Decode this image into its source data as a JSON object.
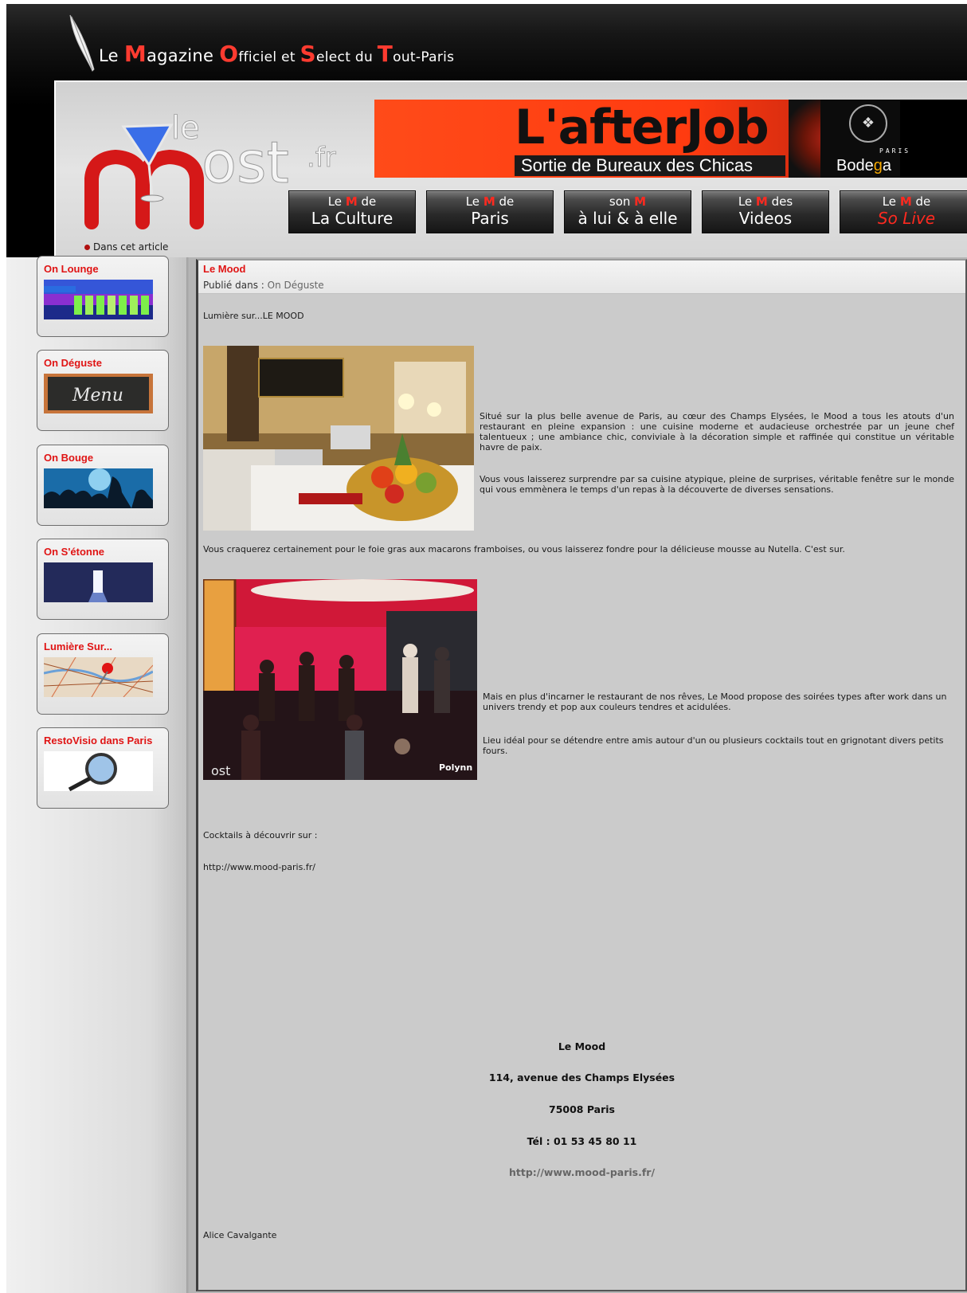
{
  "header": {
    "tagline": {
      "w1": "Le ",
      "c1": "M",
      "w2": "agazine ",
      "c2": "O",
      "w3": "fficiel ",
      "w4": "et ",
      "c3": "S",
      "w5": "elect ",
      "w6": "du ",
      "c4": "T",
      "w7": "out-Paris"
    },
    "logo": {
      "part1": "le",
      "part2": "ost",
      "part3": ".fr"
    },
    "banner": {
      "title": "L'afterJob",
      "subtitle": "Sortie de Bureaux des Chicas",
      "brand_paris": "PARIS",
      "brand_bodega_1": "Bode",
      "brand_bodega_2": "g",
      "brand_bodega_3": "a"
    },
    "nav": [
      {
        "pre": "Le ",
        "m": "M",
        "post": " de",
        "label": "La Culture"
      },
      {
        "pre": "Le ",
        "m": "M",
        "post": " de",
        "label": "Paris"
      },
      {
        "pre": "son ",
        "m": "M",
        "post": "",
        "label": "à lui & à elle"
      },
      {
        "pre": "Le ",
        "m": "M",
        "post": " des",
        "label": "Videos"
      },
      {
        "pre": "Le ",
        "m": "M",
        "post": " de",
        "label": "So Live"
      }
    ],
    "dans_cet_article": "Dans cet article"
  },
  "sidebar": {
    "items": [
      {
        "title": "On Lounge"
      },
      {
        "title": "On Déguste",
        "menu_word": "Menu"
      },
      {
        "title": "On Bouge"
      },
      {
        "title": "On S'étonne"
      },
      {
        "title": "Lumière Sur..."
      },
      {
        "title": "RestoVisio dans Paris"
      }
    ]
  },
  "article": {
    "title": "Le Mood",
    "published_label": "Publié dans : ",
    "category": "On Déguste",
    "intro": "Lumière sur...LE MOOD",
    "p1": "Situé sur la plus belle avenue de Paris, au cœur des Champs Elysées, le Mood a tous les atouts d'un restaurant en pleine expansion : une cuisine moderne et audacieuse orchestrée par un jeune chef talentueux ; une ambiance chic, conviviale à la décoration simple et raffinée qui constitue un véritable havre de paix.",
    "p2": "Vous vous laisserez surprendre par sa cuisine atypique, pleine de surprises, véritable fenêtre sur le monde qui vous emmènera le temps d'un repas à la découverte de diverses sensations.",
    "p3": "Vous craquerez certainement pour le foie gras aux macarons framboises, ou vous laisserez fondre pour la délicieuse mousse au Nutella. C'est sur.",
    "p4": "Mais en plus d'incarner le restaurant de nos rêves, Le Mood propose des soirées types after work dans un univers trendy et pop aux couleurs tendres et acidulées.",
    "p5": "Lieu idéal pour se détendre entre amis autour d'un ou plusieurs cocktails tout en grignotant divers petits fours.",
    "photo2_credit": "Polynn",
    "photo2_watermark": "ost",
    "cocktails_label": "Cocktails à découvrir sur :",
    "url": "http://www.mood-paris.fr/",
    "footer": {
      "name": "Le Mood",
      "address": "114, avenue des Champs Elysées",
      "city": "75008 Paris",
      "phone": "Tél : 01 53 45 80 11",
      "url": "http://www.mood-paris.fr/"
    },
    "author": "Alice Cavalgante"
  }
}
